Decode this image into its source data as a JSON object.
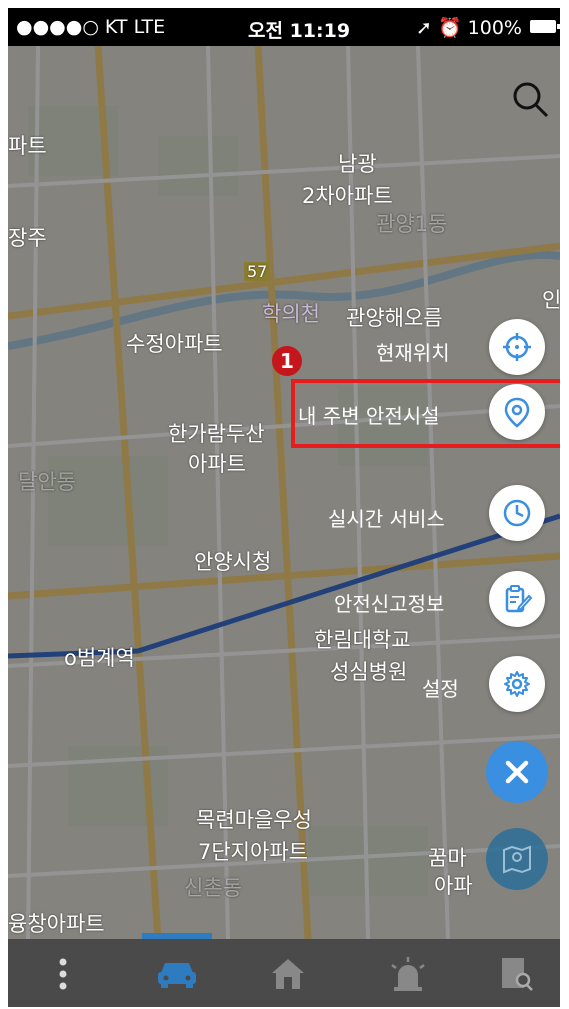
{
  "status_bar": {
    "carrier": "●●●●○ KT  LTE",
    "time": "오전 11:19",
    "battery": "100%"
  },
  "map": {
    "labels": [
      {
        "id": "l1",
        "text": "파트"
      },
      {
        "id": "l2",
        "text": "남광"
      },
      {
        "id": "l3",
        "text": "2차아파트"
      },
      {
        "id": "l4",
        "text": "관양1동"
      },
      {
        "id": "l5",
        "text": "장주"
      },
      {
        "id": "l6",
        "text": "57"
      },
      {
        "id": "l7",
        "text": "학의천"
      },
      {
        "id": "l8",
        "text": "관양해오름"
      },
      {
        "id": "l9",
        "text": "수정아파트"
      },
      {
        "id": "l10",
        "text": "한가람두산"
      },
      {
        "id": "l11",
        "text": "아파트"
      },
      {
        "id": "l12",
        "text": "달안동"
      },
      {
        "id": "l13",
        "text": "안양시청"
      },
      {
        "id": "l14",
        "text": "o범계역"
      },
      {
        "id": "l15",
        "text": "한림대학교"
      },
      {
        "id": "l16",
        "text": "성심병원"
      },
      {
        "id": "l17",
        "text": "목련마을우성"
      },
      {
        "id": "l18",
        "text": "7단지아파트"
      },
      {
        "id": "l19",
        "text": "신촌동"
      },
      {
        "id": "l20",
        "text": "꿈마"
      },
      {
        "id": "l21",
        "text": "아파"
      },
      {
        "id": "l22",
        "text": "융창아파트"
      },
      {
        "id": "l23",
        "text": "인"
      }
    ]
  },
  "menu": {
    "current_location": "현재위치",
    "nearby_safety": "내 주변 안전시설",
    "realtime_service": "실시간 서비스",
    "safety_report": "안전신고정보",
    "settings": "설정"
  },
  "annotation": {
    "step_number": "1",
    "highlight_color": "#e41e1e"
  },
  "icons": {
    "search": "search-icon",
    "crosshair": "crosshair-icon",
    "pin": "location-pin-icon",
    "clock": "clock-icon",
    "report": "report-edit-icon",
    "gear": "gear-icon",
    "close": "close-icon",
    "map": "map-icon"
  },
  "colors": {
    "accent": "#3a8fe0",
    "tabbar": "#4a4a4a",
    "active_tab": "#2e7bbf"
  }
}
